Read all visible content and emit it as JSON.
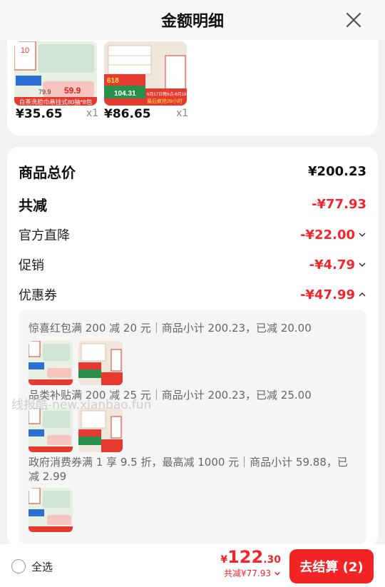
{
  "header": {
    "title": "金额明细"
  },
  "products": [
    {
      "price": "¥35.65",
      "qty": "x1",
      "img_top": "10",
      "img_mid": "79.9",
      "img_price": "59.9",
      "img_caption": "白茶洗脸巾悬挂式80抽*8包"
    },
    {
      "price": "¥86.65",
      "qty": "x1",
      "img_badge": "618",
      "img_price": "104.31",
      "img_red1": "6月17日晚8点-6月18日",
      "img_red2": "最后疯抢28小时"
    }
  ],
  "summary": {
    "total_label": "商品总价",
    "total_value": "¥200.23",
    "reduce_label": "共减",
    "reduce_value": "-¥77.93",
    "official_label": "官方直降",
    "official_value": "-¥22.00",
    "promo_label": "促销",
    "promo_value": "-¥4.79",
    "coupon_label": "优惠券",
    "coupon_value": "-¥47.99"
  },
  "coupons": [
    {
      "desc": "惊喜红包满 200 减 20 元｜商品小计 200.23，已减 20.00"
    },
    {
      "desc": "品类补贴满 200 减 25 元｜商品小计 200.23，已减 25.00"
    },
    {
      "desc": "政府消费券满 1 享 9.5 折，最高减 1000 元｜商品小计 59.88，已减 2.99"
    }
  ],
  "watermark": "线报酷-new.xianbao.fun",
  "bottom": {
    "select_all": "全选",
    "currency": "¥",
    "total_int": "122",
    "total_dec": ".30",
    "reduced": "共减¥77.93",
    "checkout": "去结算 (2)"
  },
  "colors": {
    "accent": "#f0262c",
    "button": "#f22424"
  }
}
